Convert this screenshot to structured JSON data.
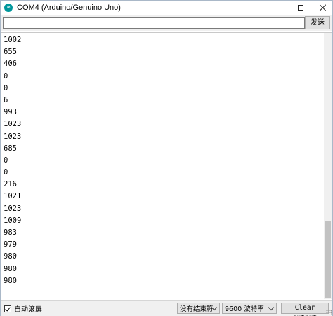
{
  "window": {
    "title": "COM4 (Arduino/Genuino Uno)",
    "app_icon_glyph": "∞",
    "controls": [
      "minimize-icon",
      "maximize-icon",
      "close-icon"
    ]
  },
  "input": {
    "value": "",
    "send_label": "发送"
  },
  "output": {
    "lines": [
      "1002",
      "655",
      "406",
      "0",
      "0",
      "6",
      "993",
      "1023",
      "1023",
      "685",
      "0",
      "0",
      "216",
      "1021",
      "1023",
      "1009",
      "983",
      "979",
      "980",
      "980",
      "980"
    ]
  },
  "footer": {
    "autoscroll_label": "自动滚屏",
    "autoscroll_checked": true,
    "line_ending": "没有结束符",
    "baud_rate": "9600 波特率",
    "clear_label": "Clear output"
  },
  "colors": {
    "app_icon": "#00979c",
    "toolbar_bg": "#f0f0f0"
  }
}
